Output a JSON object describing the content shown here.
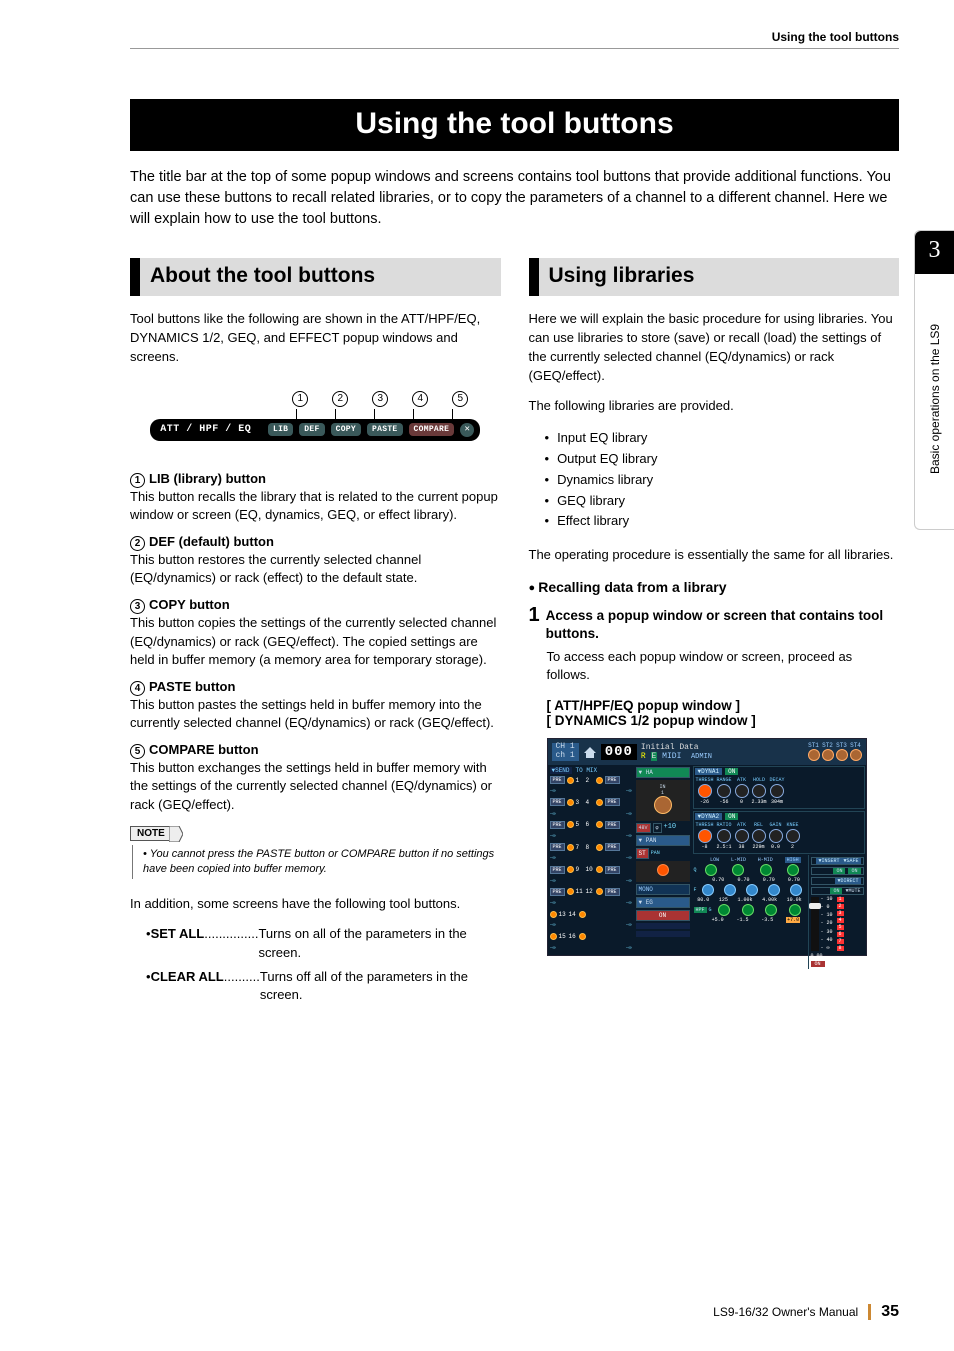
{
  "running_head": "Using the tool buttons",
  "main_title": "Using the tool buttons",
  "lead": "The title bar at the top of some popup windows and screens contains tool buttons that provide additional functions. You can use these buttons to recall related libraries, or to copy the parameters of a channel to a different channel. Here we will explain how to use the tool buttons.",
  "left": {
    "title": "About the tool buttons",
    "intro": "Tool buttons like the following are shown in the ATT/HPF/EQ, DYNAMICS 1/2, GEQ, and EFFECT popup windows and screens.",
    "callouts": [
      "1",
      "2",
      "3",
      "4",
      "5"
    ],
    "toolbar": {
      "label": "ATT / HPF / EQ",
      "btns": [
        "LIB",
        "DEF",
        "COPY",
        "PASTE",
        "COMPARE"
      ],
      "close": "✕"
    },
    "items": [
      {
        "n": "1",
        "h": "LIB (library) button",
        "p": "This button recalls the library that is related to the current popup window or screen (EQ, dynamics, GEQ, or effect library)."
      },
      {
        "n": "2",
        "h": "DEF (default) button",
        "p": "This button restores the currently selected channel (EQ/dynamics) or rack (effect) to the default state."
      },
      {
        "n": "3",
        "h": "COPY button",
        "p": "This button copies the settings of the currently selected channel (EQ/dynamics) or rack (GEQ/effect). The copied settings are held in buffer memory (a memory area for temporary storage)."
      },
      {
        "n": "4",
        "h": "PASTE button",
        "p": "This button pastes the settings held in buffer memory into the currently selected channel (EQ/dynamics) or rack (GEQ/effect)."
      },
      {
        "n": "5",
        "h": "COMPARE button",
        "p": "This button exchanges the settings held in buffer memory with the settings of the currently selected channel (EQ/dynamics) or rack (GEQ/effect)."
      }
    ],
    "note_label": "NOTE",
    "note": "You cannot press the PASTE button or COMPARE button if no settings have been copied into buffer memory.",
    "addition": "In addition, some screens have the following tool buttons.",
    "extra": [
      {
        "term": "SET ALL",
        "dots": "...............",
        "desc": "Turns on all of the parameters in the screen."
      },
      {
        "term": "CLEAR ALL",
        "dots": "..........",
        "desc": "Turns off all of the parameters in the screen."
      }
    ]
  },
  "right": {
    "title": "Using libraries",
    "intro": "Here we will explain the basic procedure for using libraries. You can use libraries to store (save) or recall (load) the settings of the currently selected channel (EQ/dynamics) or rack (GEQ/effect).",
    "list_intro": "The following libraries are provided.",
    "libs": [
      "Input EQ library",
      "Output EQ library",
      "Dynamics library",
      "GEQ library",
      "Effect library"
    ],
    "outro": "The operating procedure is essentially the same for all libraries.",
    "sub_h": "Recalling data from a library",
    "step1_h": "Access a popup window or screen that contains tool buttons.",
    "step1_p": "To access each popup window or screen, proceed as follows.",
    "win1": "[ ATT/HPF/EQ popup window ]",
    "win2": "[ DYNAMICS 1/2 popup window ]",
    "ss": {
      "ch": "CH 1\nch 1",
      "scene_num": "000",
      "scene_name": "Initial Data",
      "adm": "ADMIN",
      "st": [
        "ST1",
        "ST2",
        "ST3",
        "ST4"
      ],
      "send": "▼SEND",
      "tomix": "TO MIX",
      "ha": "▼ HA",
      "in": "IN\n1",
      "g48": "48V",
      "phase": "φ",
      "plus": "+10",
      "pan": "▼ PAN",
      "panl": "PAN",
      "st_on": "ST",
      "mono": "MONO",
      "eg": "▼ EG",
      "on": "ON",
      "dyn1": "▼DYNA1",
      "dyn2": "▼DYNA2",
      "d1l": [
        "THRESH",
        "RANGE",
        "ATK",
        "HOLD",
        "DECAY"
      ],
      "d1v": [
        "-26",
        "-56",
        "0",
        "2.33m",
        "304m"
      ],
      "d2l": [
        "THRESH",
        "RATIO",
        "ATK",
        "REL",
        "GAIN",
        "KNEE"
      ],
      "d2v": [
        "-8",
        "2.5:1",
        "38",
        "229m",
        "0.0",
        "2"
      ],
      "eqh": [
        "LOW",
        "L-MID",
        "H-MID",
        "HIGH"
      ],
      "eqq": [
        "0.70",
        "0.70",
        "0.70",
        "0.70"
      ],
      "eqf": [
        "80.0",
        "125",
        "1.00k",
        "4.00k",
        "10.0k"
      ],
      "eqg": [
        "+5.0",
        "-1.5",
        "-3.5",
        "+7.0"
      ],
      "q": "Q",
      "f": "F",
      "g": "G",
      "hpf": "HPF",
      "ins": "▼INSERT",
      "safe": "▼SAFE",
      "dir": "▼DIRECT",
      "mute": "▼MUTE",
      "scale": [
        "- 10",
        "- 0",
        "- 10",
        "- 20",
        "- 30",
        "- 40",
        "- ∞"
      ],
      "val": "0.00",
      "fon": "ON",
      "mlab": [
        "1",
        "2",
        "3",
        "4",
        "5",
        "6",
        "7",
        "8"
      ]
    }
  },
  "side": {
    "num": "3",
    "txt": "Basic operations on the LS9"
  },
  "footer": {
    "manual": "LS9-16/32  Owner's Manual",
    "page": "35"
  }
}
